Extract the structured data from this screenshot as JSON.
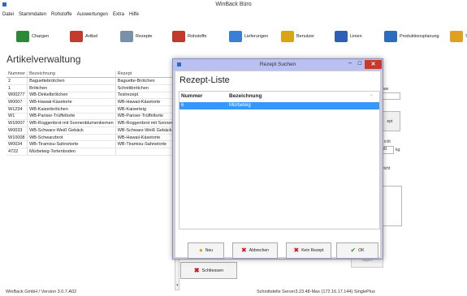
{
  "window": {
    "title": "WinBack Büro"
  },
  "menu": [
    "Datei",
    "Stammdaten",
    "Rohstoffe",
    "Auswertungen",
    "Extra",
    "Hilfe"
  ],
  "toolbar": [
    {
      "label": "Chargen",
      "icon": "batch-icon",
      "color": "#2a8a3a"
    },
    {
      "label": "Artikel",
      "icon": "article-icon",
      "color": "#c23b2e"
    },
    {
      "label": "Rezepte",
      "icon": "recipe-icon",
      "color": "#7a8fa8"
    },
    {
      "label": "Rohstoffe",
      "icon": "raw-materials-icon",
      "color": "#c0392b"
    },
    {
      "label": "Lieferungen",
      "icon": "delivery-icon",
      "color": "#3a7fd5"
    },
    {
      "label": "Benutzer",
      "icon": "user-icon",
      "color": "#d9a514"
    },
    {
      "label": "Linien",
      "icon": "lines-icon",
      "color": "#2d5fb5"
    },
    {
      "label": "Produktionsplanung",
      "icon": "planning-icon",
      "color": "#2d6bbf"
    },
    {
      "label": "Sc",
      "icon": "settings-icon",
      "color": "#e0a020"
    }
  ],
  "page": {
    "title": "Artikelverwaltung"
  },
  "table": {
    "headers": [
      "Nummer",
      "Bezeichnung",
      "Rezept"
    ],
    "rows": [
      [
        "2",
        "Baguettebrötchen",
        "Baguette-Brötchen"
      ],
      [
        "1",
        "Brötchen",
        "Schnittbrötchen"
      ],
      [
        "W00277",
        "WB-Dinkelbrötchen",
        "Testrezept"
      ],
      [
        "W0007",
        "WB-Hawaii-Käsetorte",
        "WB-Hawaii-Käsetorte"
      ],
      [
        "W1234",
        "WB-Kaiserbrötchen",
        "WB-Kaiserteig"
      ],
      [
        "W1",
        "WB-Pariser-Trüffeltorte",
        "WB-Pariser-Trüffeltorte"
      ],
      [
        "W10007",
        "WB-Roggenbrot mit Sonnenblumenkernen",
        "WB-Roggenbrot mit Sonnenblumenkernen"
      ],
      [
        "W0033",
        "WB-Schwarz-Weiß Gebäck",
        "WB-Schwarz-Weiß Gebäck"
      ],
      [
        "W10008",
        "WB-Schwarzbrot",
        "WB-Hawaii-Käsetorte"
      ],
      [
        "W0034",
        "WB-Tiramisu-Sahnetorte",
        "WB-Tiramisu-Sahnetorte"
      ],
      [
        "4722",
        "Mürbeteig-Tortenboden",
        ""
      ]
    ]
  },
  "background": {
    "label_ww": "ww",
    "label_ept": "ept",
    "label_icht": "icht",
    "kg_value": "50",
    "kg_unit": "kg",
    "label_wicht": "wicht",
    "close_label": "Schliessen",
    "grey_button": "ragen"
  },
  "status": {
    "left": "WinBack GmbH / Version 3.0.7.A02",
    "right": "Schnittstelle Server3.23.48-Max (172.16.17.144) SinglePlus"
  },
  "dialog": {
    "title": "Rezept Suchen",
    "heading": "Rezept-Liste",
    "columns": [
      "Nummer",
      "Bezeichnung"
    ],
    "rows": [
      [
        "6",
        "Mürbeteig"
      ]
    ],
    "buttons": {
      "new": "Neu",
      "cancel": "Abbrechen",
      "no_recipe": "Kein Rezept",
      "ok": "OK"
    }
  }
}
